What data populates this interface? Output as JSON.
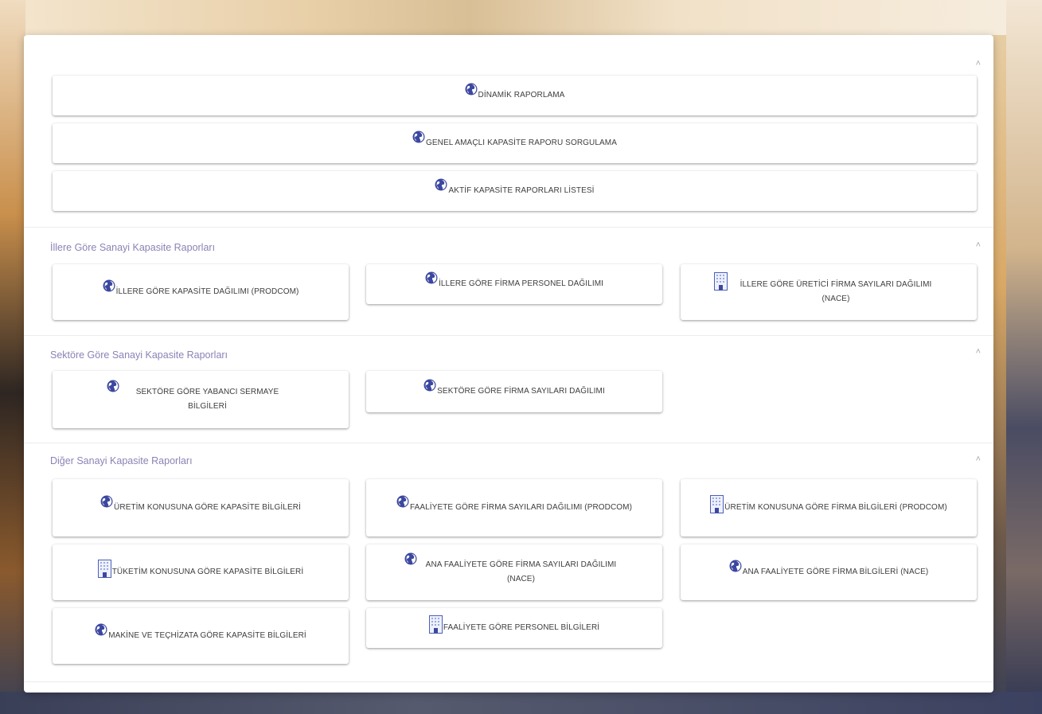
{
  "top_links": [
    {
      "label": "DİNAMİK RAPORLAMA",
      "icon": "globe-icon"
    },
    {
      "label": "GENEL AMAÇLI KAPASİTE RAPORU SORGULAMA",
      "icon": "globe-icon"
    },
    {
      "label": "AKTİF KAPASİTE RAPORLARI LİSTESİ",
      "icon": "globe-icon"
    }
  ],
  "sections": [
    {
      "title": "İllere Göre Sanayi Kapasite Raporları",
      "items": [
        {
          "label": "İLLERE GÖRE KAPASİTE DAĞILIMI (PRODCOM)",
          "icon": "globe-icon"
        },
        {
          "label": "İLLERE GÖRE FİRMA PERSONEL DAĞILIMI",
          "icon": "globe-icon"
        },
        {
          "label": "İLLERE GÖRE ÜRETİCİ FİRMA SAYILARI DAĞILIMI (NACE)",
          "icon": "building-icon"
        }
      ]
    },
    {
      "title": "Sektöre Göre Sanayi Kapasite Raporları",
      "items": [
        {
          "label": "SEKTÖRE GÖRE YABANCI SERMAYE BİLGİLERİ",
          "icon": "globe-icon"
        },
        {
          "label": "SEKTÖRE GÖRE FİRMA SAYILARI DAĞILIMI",
          "icon": "globe-icon"
        }
      ]
    },
    {
      "title": "Diğer Sanayi Kapasite Raporları",
      "items": [
        {
          "label": "ÜRETİM KONUSUNA GÖRE KAPASİTE BİLGİLERİ",
          "icon": "globe-icon"
        },
        {
          "label": "FAALİYETE GÖRE FİRMA SAYILARI DAĞILIMI (PRODCOM)",
          "icon": "globe-icon"
        },
        {
          "label": "ÜRETİM KONUSUNA GÖRE FİRMA BİLGİLERİ (PRODCOM)",
          "icon": "building-icon"
        },
        {
          "label": "TÜKETİM KONUSUNA GÖRE KAPASİTE BİLGİLERİ",
          "icon": "building-icon"
        },
        {
          "label": "ANA FAALİYETE GÖRE FİRMA SAYILARI DAĞILIMI (NACE)",
          "icon": "globe-icon"
        },
        {
          "label": "ANA FAALİYETE GÖRE FİRMA BİLGİLERİ (NACE)",
          "icon": "globe-icon"
        },
        {
          "label": "MAKİNE VE TEÇHİZATA GÖRE KAPASİTE BİLGİLERİ",
          "icon": "globe-icon"
        },
        {
          "label": "FAALİYETE GÖRE PERSONEL BİLGİLERİ",
          "icon": "building-icon"
        }
      ]
    }
  ],
  "collapse_glyph": "˄",
  "colors": {
    "accent": "#3c48a0",
    "section_title": "#8b83b6"
  }
}
